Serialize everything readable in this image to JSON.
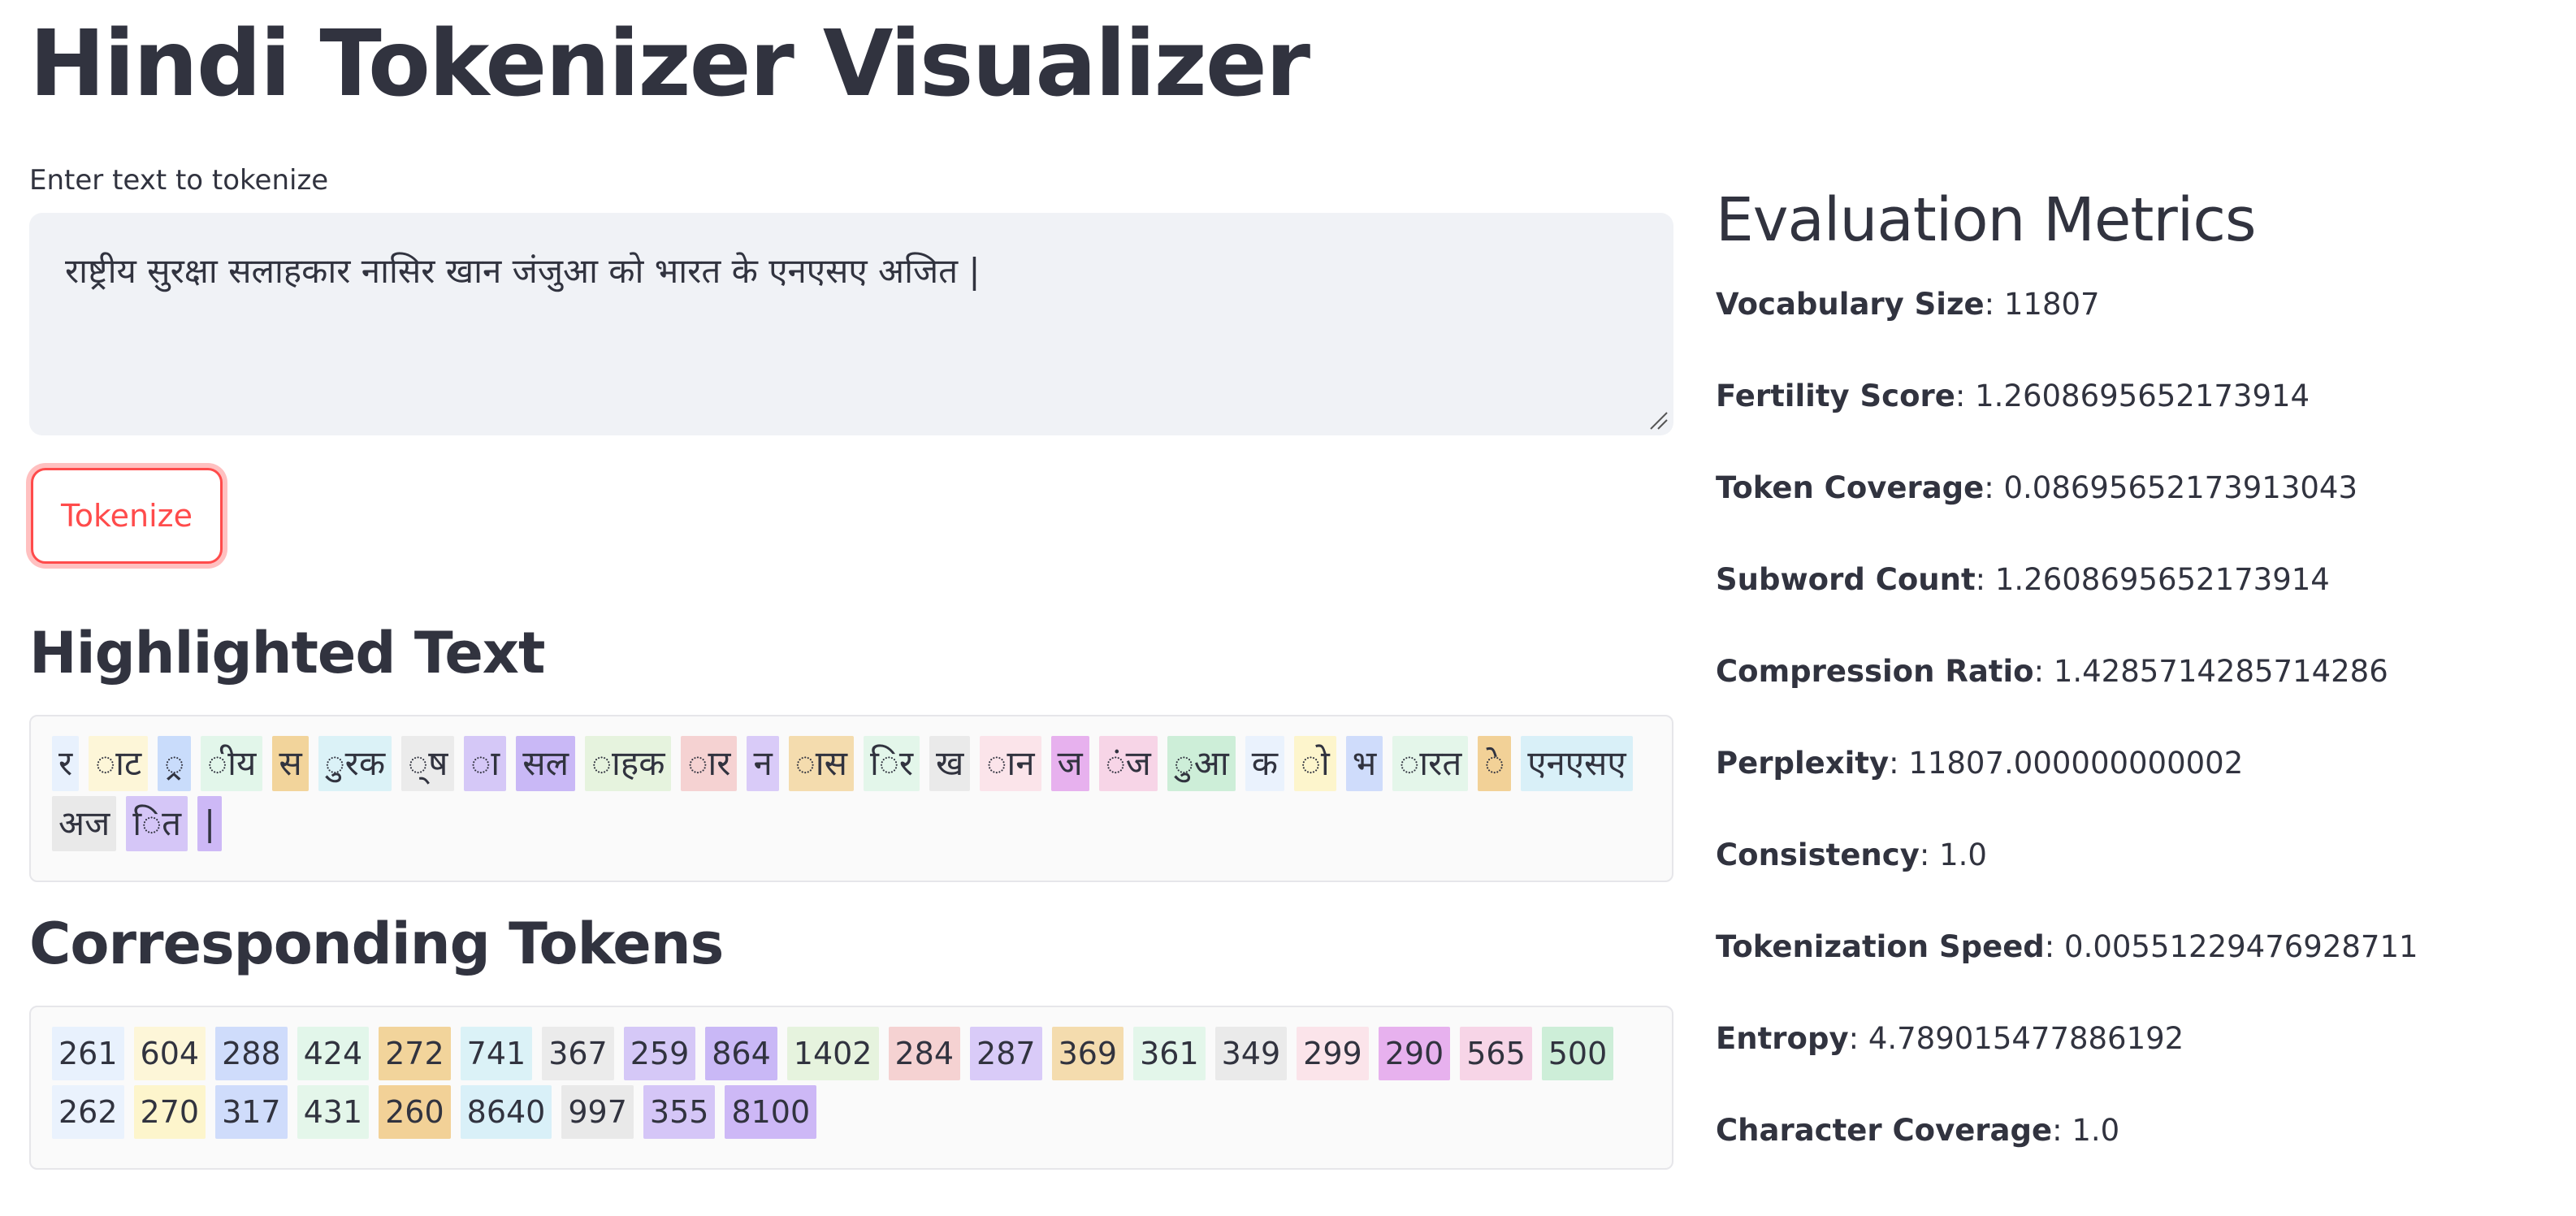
{
  "title": "Hindi Tokenizer Visualizer",
  "input": {
    "label": "Enter text to tokenize",
    "value": "राष्ट्रीय सुरक्षा सलाहकार नासिर खान जंजुआ को भारत के एनएसए अजित |"
  },
  "tokenize_button": "Tokenize",
  "highlighted": {
    "heading": "Highlighted Text",
    "segments": [
      {
        "text": "र",
        "color": "#e8f1fd"
      },
      {
        "text": "ाट",
        "color": "#fdf6d8"
      },
      {
        "text": "्र",
        "color": "#c9dcfb"
      },
      {
        "text": "ीय",
        "color": "#e2f6ea"
      },
      {
        "text": "स",
        "color": "#f2d49b"
      },
      {
        "text": "ुरक",
        "color": "#dbf2f7"
      },
      {
        "text": "्ष",
        "color": "#ebebeb"
      },
      {
        "text": "ा",
        "color": "#d5c8f7"
      },
      {
        "text": "सल",
        "color": "#c9b8f6"
      },
      {
        "text": "ाहक",
        "color": "#e6f3de"
      },
      {
        "text": "ार",
        "color": "#f5d2d2"
      },
      {
        "text": "न",
        "color": "#d9cbf8"
      },
      {
        "text": "ास",
        "color": "#f4dcae"
      },
      {
        "text": "िर",
        "color": "#e3f6ea"
      },
      {
        "text": "ख",
        "color": "#eaeaea"
      },
      {
        "text": "ान",
        "color": "#fbe4ea"
      },
      {
        "text": "ज",
        "color": "#e7b1ee"
      },
      {
        "text": "ंज",
        "color": "#f7d5e7"
      },
      {
        "text": "ुआ",
        "color": "#cdeed8"
      },
      {
        "text": "क",
        "color": "#eaf2fd"
      },
      {
        "text": "ो",
        "color": "#fdf5cc"
      },
      {
        "text": "भ",
        "color": "#cfdcfb"
      },
      {
        "text": "ारत",
        "color": "#e4f6ea"
      },
      {
        "text": "े",
        "color": "#f2d197"
      },
      {
        "text": "एनएसए",
        "color": "#d9f0f8"
      },
      {
        "text": "अज",
        "color": "#e9e9e9"
      },
      {
        "text": "ित",
        "color": "#d5c6f7"
      },
      {
        "text": "|",
        "color": "#cdb8f6"
      }
    ]
  },
  "tokens": {
    "heading": "Corresponding Tokens",
    "items": [
      {
        "text": "261",
        "color": "#e8f1fd"
      },
      {
        "text": "604",
        "color": "#fdf6d8"
      },
      {
        "text": "288",
        "color": "#cfdcfb"
      },
      {
        "text": "424",
        "color": "#e2f6ea"
      },
      {
        "text": "272",
        "color": "#f2d49b"
      },
      {
        "text": "741",
        "color": "#dbf2f7"
      },
      {
        "text": "367",
        "color": "#ebebeb"
      },
      {
        "text": "259",
        "color": "#d5c8f7"
      },
      {
        "text": "864",
        "color": "#c9b8f6"
      },
      {
        "text": "1402",
        "color": "#e6f3de"
      },
      {
        "text": "284",
        "color": "#f5d2d2"
      },
      {
        "text": "287",
        "color": "#d9cbf8"
      },
      {
        "text": "369",
        "color": "#f4dcae"
      },
      {
        "text": "361",
        "color": "#e3f6ea"
      },
      {
        "text": "349",
        "color": "#eaeaea"
      },
      {
        "text": "299",
        "color": "#fbe4ea"
      },
      {
        "text": "290",
        "color": "#e7b1ee"
      },
      {
        "text": "565",
        "color": "#f7d5e7"
      },
      {
        "text": "500",
        "color": "#cdeed8"
      },
      {
        "text": "262",
        "color": "#eaf2fd"
      },
      {
        "text": "270",
        "color": "#fdf5cc"
      },
      {
        "text": "317",
        "color": "#cfdcfb"
      },
      {
        "text": "431",
        "color": "#e4f6ea"
      },
      {
        "text": "260",
        "color": "#f2d197"
      },
      {
        "text": "8640",
        "color": "#d9f0f8"
      },
      {
        "text": "997",
        "color": "#e9e9e9"
      },
      {
        "text": "355",
        "color": "#d5c6f7"
      },
      {
        "text": "8100",
        "color": "#cdb8f6"
      }
    ]
  },
  "metrics": {
    "heading": "Evaluation Metrics",
    "items": [
      {
        "label": "Vocabulary Size",
        "value": "11807"
      },
      {
        "label": "Fertility Score",
        "value": "1.2608695652173914"
      },
      {
        "label": "Token Coverage",
        "value": "0.08695652173913043"
      },
      {
        "label": "Subword Count",
        "value": "1.2608695652173914"
      },
      {
        "label": "Compression Ratio",
        "value": "1.4285714285714286"
      },
      {
        "label": "Perplexity",
        "value": "11807.000000000002"
      },
      {
        "label": "Consistency",
        "value": "1.0"
      },
      {
        "label": "Tokenization Speed",
        "value": "0.00551229476928711"
      },
      {
        "label": "Entropy",
        "value": "4.789015477886192"
      },
      {
        "label": "Character Coverage",
        "value": "1.0"
      }
    ]
  }
}
